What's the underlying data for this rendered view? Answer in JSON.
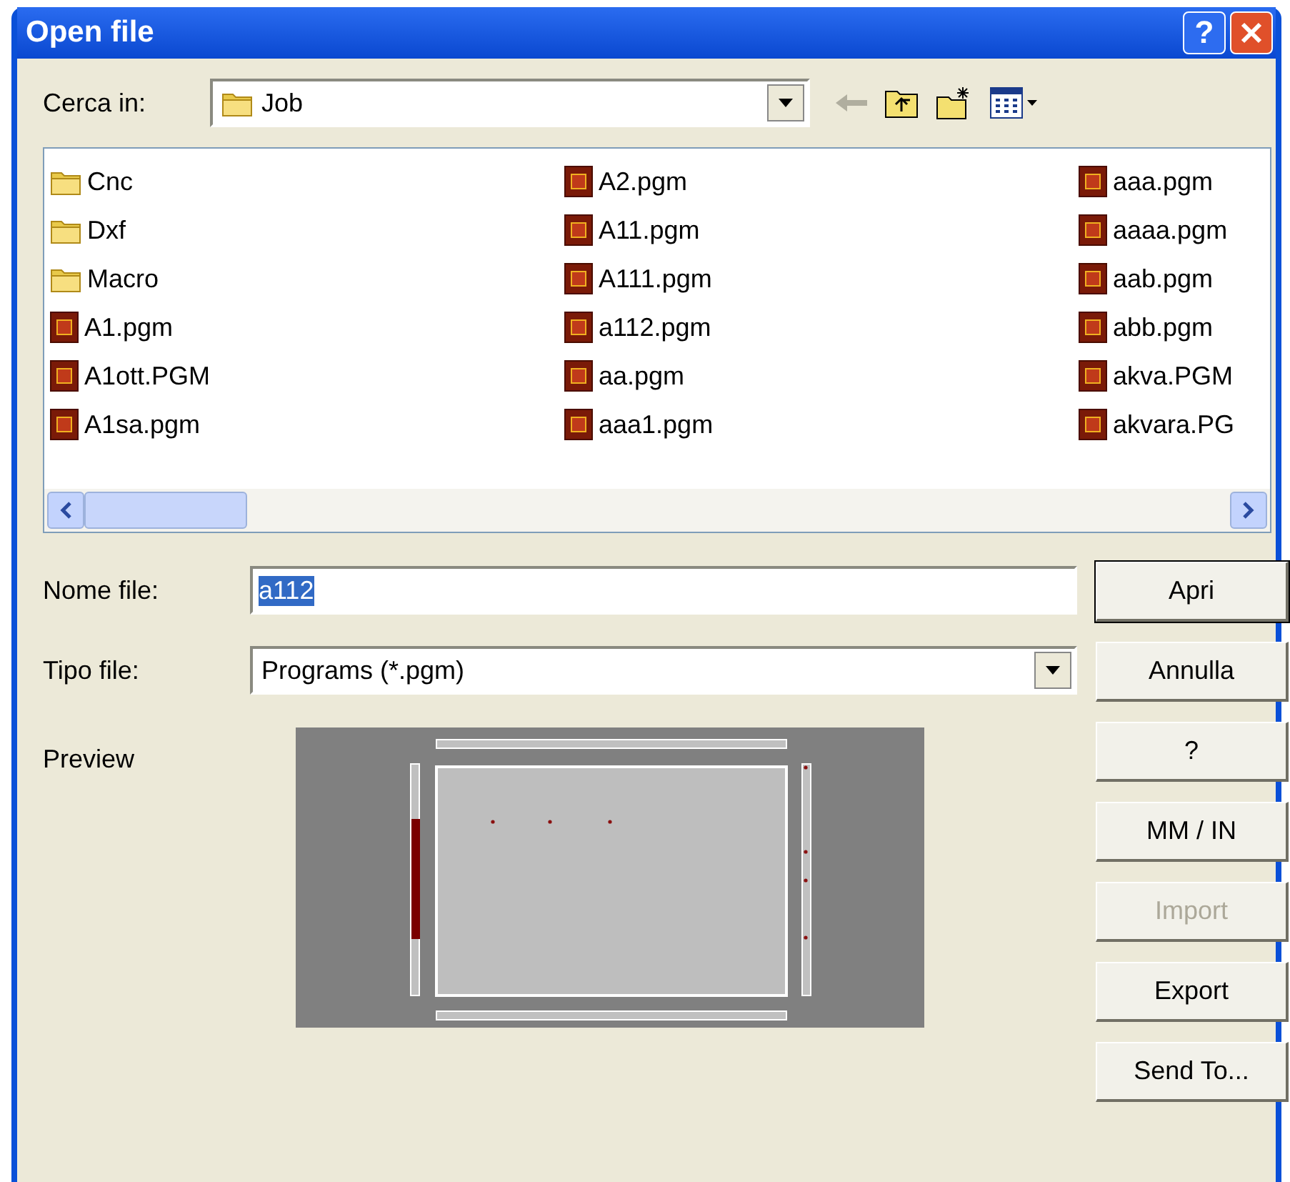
{
  "window": {
    "title": "Open file",
    "help_button": "?"
  },
  "look_in": {
    "label": "Cerca in:",
    "value": "Job"
  },
  "toolbar": [
    {
      "kind": "back",
      "disabled": true
    },
    {
      "kind": "up",
      "disabled": false
    },
    {
      "kind": "newfolder",
      "disabled": false
    },
    {
      "kind": "view",
      "disabled": false
    }
  ],
  "files": [
    {
      "name": "Cnc",
      "kind": "folder"
    },
    {
      "name": "Dxf",
      "kind": "folder"
    },
    {
      "name": "Macro",
      "kind": "folder"
    },
    {
      "name": "A1.pgm",
      "kind": "program"
    },
    {
      "name": "A1ott.PGM",
      "kind": "program"
    },
    {
      "name": "A1sa.pgm",
      "kind": "program"
    },
    {
      "name": "A2.pgm",
      "kind": "program"
    },
    {
      "name": "A11.pgm",
      "kind": "program"
    },
    {
      "name": "A111.pgm",
      "kind": "program"
    },
    {
      "name": "a112.pgm",
      "kind": "program"
    },
    {
      "name": "aa.pgm",
      "kind": "program"
    },
    {
      "name": "aaa1.pgm",
      "kind": "program"
    },
    {
      "name": "aaa.pgm",
      "kind": "program"
    },
    {
      "name": "aaaa.pgm",
      "kind": "program"
    },
    {
      "name": "aab.pgm",
      "kind": "program"
    },
    {
      "name": "abb.pgm",
      "kind": "program"
    },
    {
      "name": "akva.PGM",
      "kind": "program"
    },
    {
      "name": "akvara.PG",
      "kind": "program"
    }
  ],
  "file_name": {
    "label": "Nome file:",
    "value": "a112",
    "value_selected": true
  },
  "file_type": {
    "label": "Tipo file:",
    "value": "Programs (*.pgm)"
  },
  "preview": {
    "label": "Preview"
  },
  "buttons": [
    {
      "label": "Apri",
      "default": true,
      "disabled": false
    },
    {
      "label": "Annulla",
      "default": false,
      "disabled": false
    },
    {
      "label": "?",
      "default": false,
      "disabled": false
    },
    {
      "label": "MM / IN",
      "default": false,
      "disabled": false
    },
    {
      "label": "Import",
      "default": false,
      "disabled": true
    },
    {
      "label": "Export",
      "default": false,
      "disabled": false
    },
    {
      "label": "Send To...",
      "default": false,
      "disabled": false
    }
  ]
}
